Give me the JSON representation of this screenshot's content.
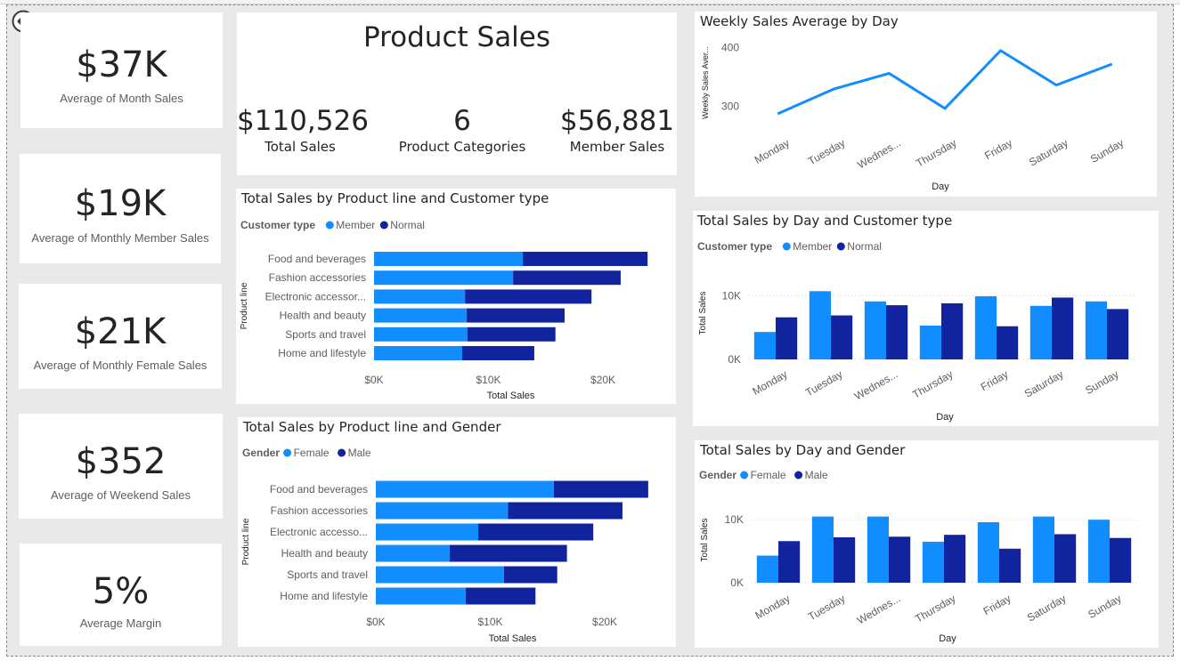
{
  "kpis": [
    {
      "value": "$37K",
      "label": "Average of Month Sales"
    },
    {
      "value": "$19K",
      "label": "Average of Monthly Member Sales"
    },
    {
      "value": "$21K",
      "label": "Average of Monthly Female Sales"
    },
    {
      "value": "$352",
      "label": "Average of Weekend Sales"
    },
    {
      "value": "5%",
      "label": "Average Margin"
    }
  ],
  "header": {
    "title": "Product Sales",
    "metrics": [
      {
        "value": "$110,526",
        "label": "Total Sales"
      },
      {
        "value": "6",
        "label": "Product Categories"
      },
      {
        "value": "$56,881",
        "label": "Member Sales"
      }
    ]
  },
  "colors": {
    "primary": "#118dff",
    "secondary": "#12239e",
    "grid": "#e6e6e6"
  },
  "icons": {
    "back": "back-arrow-icon"
  },
  "chart_data": [
    {
      "id": "weekly",
      "type": "line",
      "title": "Weekly Sales Average by Day",
      "xlabel": "Day",
      "ylabel": "Weekly Sales Aver...",
      "categories": [
        "Monday",
        "Tuesday",
        "Wednes...",
        "Thursday",
        "Friday",
        "Saturday",
        "Sunday"
      ],
      "values": [
        287,
        329,
        356,
        296,
        395,
        336,
        372
      ],
      "yticks": [
        300,
        400
      ],
      "ytick_labels": [
        "300",
        "400"
      ],
      "ylim": [
        270,
        410
      ]
    },
    {
      "id": "pl_customer",
      "type": "bar",
      "orientation": "horizontal",
      "stacked": true,
      "title": "Total Sales by Product line and Customer type",
      "legend_title": "Customer type",
      "xlabel": "Total Sales",
      "ylabel": "Product line",
      "categories": [
        "Food and beverages",
        "Fashion accessories",
        "Electronic accessor...",
        "Health and beauty",
        "Sports and travel",
        "Home and lifestyle"
      ],
      "series": [
        {
          "name": "Member",
          "values": [
            13000,
            12150,
            7950,
            8100,
            8150,
            7700
          ]
        },
        {
          "name": "Normal",
          "values": [
            10900,
            9400,
            11050,
            8550,
            7700,
            6300
          ]
        }
      ],
      "xticks": [
        0,
        10000,
        20000
      ],
      "xtick_labels": [
        "$0K",
        "$10K",
        "$20K"
      ],
      "xlim": [
        0,
        27000
      ]
    },
    {
      "id": "pl_gender",
      "type": "bar",
      "orientation": "horizontal",
      "stacked": true,
      "title": "Total Sales by Product line and Gender",
      "legend_title": "Gender",
      "xlabel": "Total Sales",
      "ylabel": "Product line",
      "categories": [
        "Food and beverages",
        "Fashion accessories",
        "Electronic accesso...",
        "Health and beauty",
        "Sports and travel",
        "Home and lifestyle"
      ],
      "series": [
        {
          "name": "Female",
          "values": [
            15550,
            11550,
            8950,
            6450,
            11200,
            7850
          ]
        },
        {
          "name": "Male",
          "values": [
            8250,
            10000,
            10050,
            10250,
            4650,
            6100
          ]
        }
      ],
      "xticks": [
        0,
        10000,
        20000
      ],
      "xtick_labels": [
        "$0K",
        "$10K",
        "$20K"
      ],
      "xlim": [
        0,
        27000
      ]
    },
    {
      "id": "day_customer",
      "type": "bar",
      "orientation": "vertical",
      "stacked": false,
      "title": "Total Sales by Day and Customer type",
      "legend_title": "Customer type",
      "xlabel": "Day",
      "ylabel": "Total Sales",
      "categories": [
        "Monday",
        "Tuesday",
        "Wednes...",
        "Thursday",
        "Friday",
        "Saturday",
        "Sunday"
      ],
      "series": [
        {
          "name": "Member",
          "values": [
            4300,
            10700,
            9100,
            5300,
            9900,
            8400,
            9100
          ]
        },
        {
          "name": "Normal",
          "values": [
            6600,
            6900,
            8500,
            8800,
            5200,
            9700,
            7900
          ]
        }
      ],
      "yticks": [
        0,
        10000
      ],
      "ytick_labels": [
        "0K",
        "10K"
      ],
      "ylim": [
        0,
        12000
      ]
    },
    {
      "id": "day_gender",
      "type": "bar",
      "orientation": "vertical",
      "stacked": false,
      "title": "Total Sales by Day and Gender",
      "legend_title": "Gender",
      "xlabel": "Day",
      "ylabel": "Total Sales",
      "categories": [
        "Monday",
        "Tuesday",
        "Wednes...",
        "Thursday",
        "Friday",
        "Saturday",
        "Sunday"
      ],
      "series": [
        {
          "name": "Female",
          "values": [
            4300,
            10500,
            10500,
            6500,
            9600,
            10500,
            10000
          ]
        },
        {
          "name": "Male",
          "values": [
            6600,
            7200,
            7300,
            7600,
            5400,
            7700,
            7100
          ]
        }
      ],
      "yticks": [
        0,
        10000
      ],
      "ytick_labels": [
        "0K",
        "10K"
      ],
      "ylim": [
        0,
        12000
      ]
    }
  ]
}
